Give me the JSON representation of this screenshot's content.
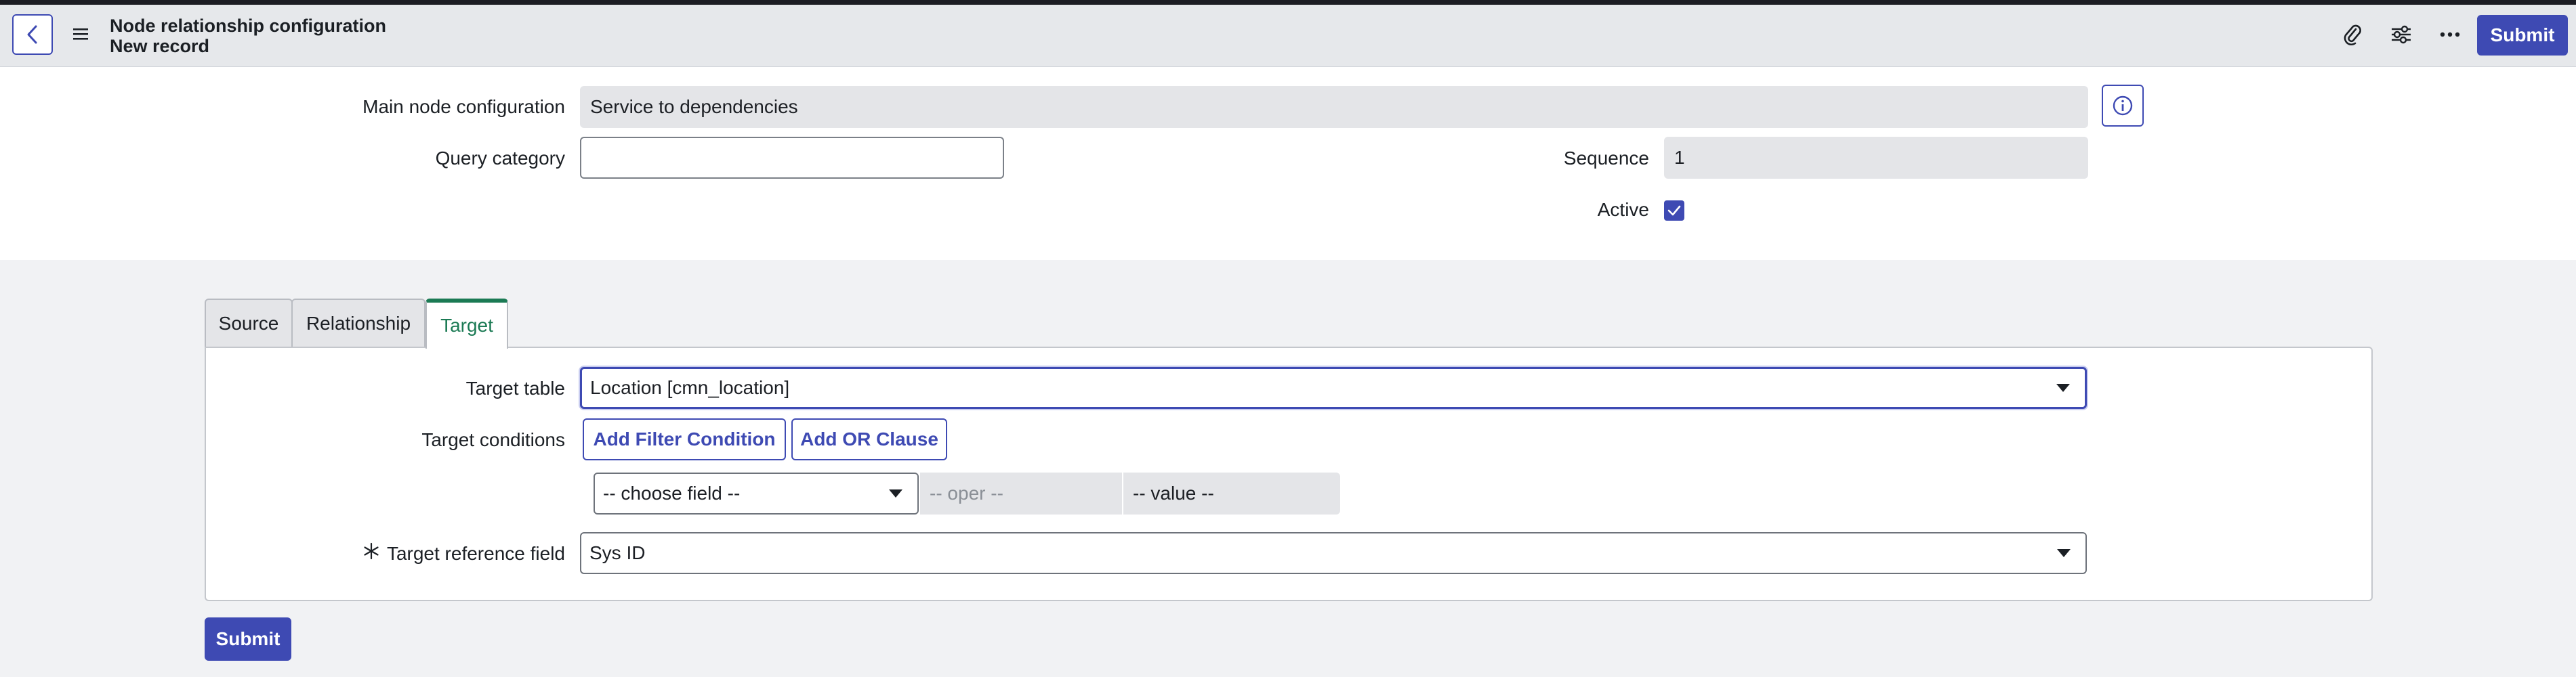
{
  "header": {
    "title": "Node relationship configuration",
    "subtitle": "New record",
    "submit_label": "Submit",
    "icons": [
      "paperclip-icon",
      "sliders-icon",
      "more-icon"
    ]
  },
  "form": {
    "main_node_label": "Main node configuration",
    "main_node_value": "Service to dependencies",
    "query_category_label": "Query category",
    "query_category_value": "",
    "sequence_label": "Sequence",
    "sequence_value": "1",
    "active_label": "Active",
    "active_checked": true
  },
  "tabs": [
    {
      "label": "Source",
      "active": false
    },
    {
      "label": "Relationship",
      "active": false
    },
    {
      "label": "Target",
      "active": true
    }
  ],
  "target": {
    "table_label": "Target table",
    "table_value": "Location [cmn_location]",
    "conditions_label": "Target conditions",
    "add_filter_label": "Add Filter Condition",
    "add_or_label": "Add OR Clause",
    "choose_field": "-- choose field --",
    "oper": "-- oper --",
    "value": "-- value --",
    "reference_label": "Target reference field",
    "reference_value": "Sys ID"
  },
  "footer": {
    "submit_label": "Submit"
  },
  "colors": {
    "accent": "#3e4ab3",
    "active_tab": "#1b7a54"
  }
}
